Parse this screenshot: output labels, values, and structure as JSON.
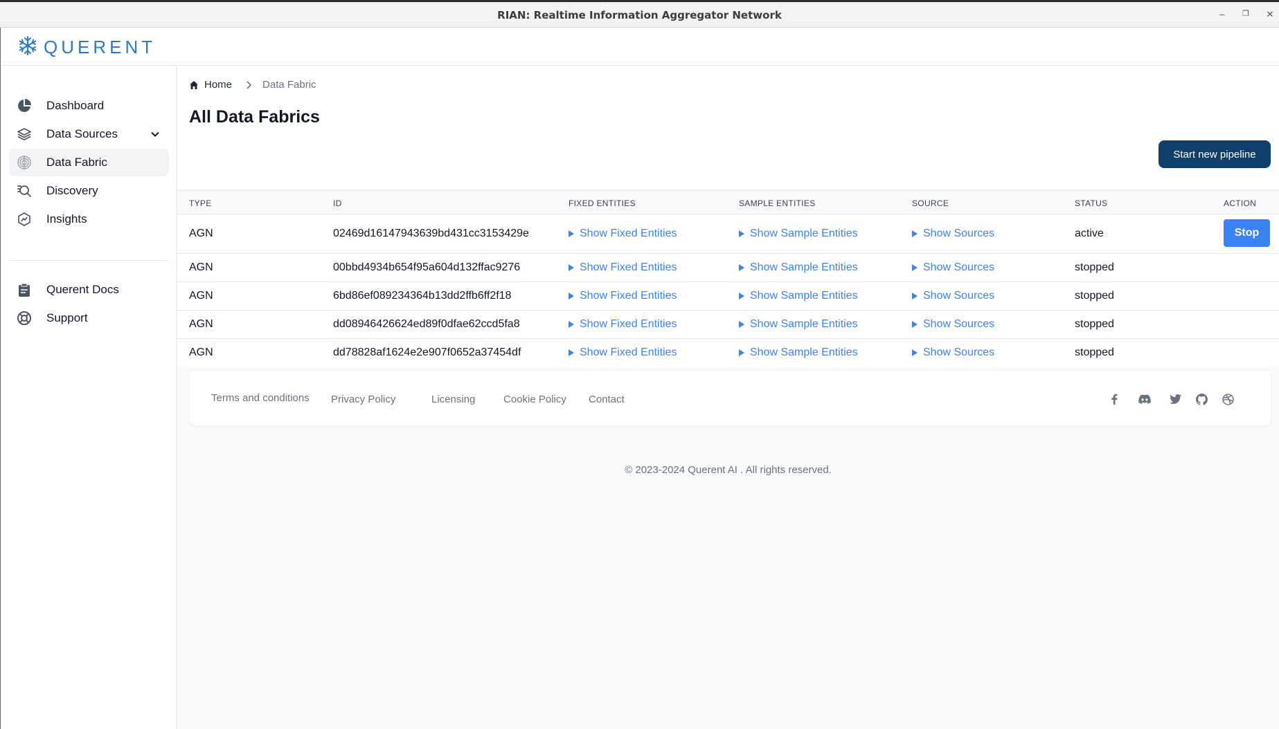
{
  "window": {
    "title": "RIAN: Realtime Information Aggregator Network"
  },
  "brand": {
    "name": "QUERENT",
    "color": "#2b7bc7"
  },
  "sidebar": {
    "items": [
      {
        "label": "Dashboard",
        "icon": "pie-chart-icon"
      },
      {
        "label": "Data Sources",
        "icon": "layers-icon",
        "expandable": true
      },
      {
        "label": "Data Fabric",
        "icon": "fingerprint-icon",
        "active": true
      },
      {
        "label": "Discovery",
        "icon": "search-document-icon"
      },
      {
        "label": "Insights",
        "icon": "hexagon-chart-icon"
      },
      {
        "label": "Querent Docs",
        "icon": "clipboard-icon"
      },
      {
        "label": "Support",
        "icon": "lifebuoy-icon"
      }
    ]
  },
  "breadcrumb": {
    "home": "Home",
    "current": "Data Fabric"
  },
  "page": {
    "title": "All Data Fabrics",
    "new_button": "Start new pipeline"
  },
  "table": {
    "headers": [
      "TYPE",
      "ID",
      "FIXED ENTITIES",
      "SAMPLE ENTITIES",
      "SOURCE",
      "STATUS",
      "ACTION"
    ],
    "fixed_link": "Show Fixed Entities",
    "sample_link": "Show Sample Entities",
    "source_link": "Show Sources",
    "stop_label": "Stop",
    "rows": [
      {
        "type": "AGN",
        "id": "02469d16147943639bd431cc3153429e",
        "status": "active"
      },
      {
        "type": "AGN",
        "id": "00bbd4934b654f95a604d132ffac9276",
        "status": "stopped"
      },
      {
        "type": "AGN",
        "id": "6bd86ef089234364b13dd2ffb6ff2f18",
        "status": "stopped"
      },
      {
        "type": "AGN",
        "id": "dd08946426624ed89f0dfae62ccd5fa8",
        "status": "stopped"
      },
      {
        "type": "AGN",
        "id": "dd78828af1624e2e907f0652a37454df",
        "status": "stopped"
      }
    ]
  },
  "footer": {
    "links": [
      "Terms and conditions",
      "Privacy Policy",
      "Licensing",
      "Cookie Policy",
      "Contact"
    ],
    "social": [
      "facebook-icon",
      "discord-icon",
      "twitter-icon",
      "github-icon",
      "dribbble-icon"
    ],
    "copyright": "© 2023-2024 Querent AI . All rights reserved."
  },
  "colors": {
    "primary_dark": "#0f3f6b",
    "link": "#3b82f6"
  }
}
